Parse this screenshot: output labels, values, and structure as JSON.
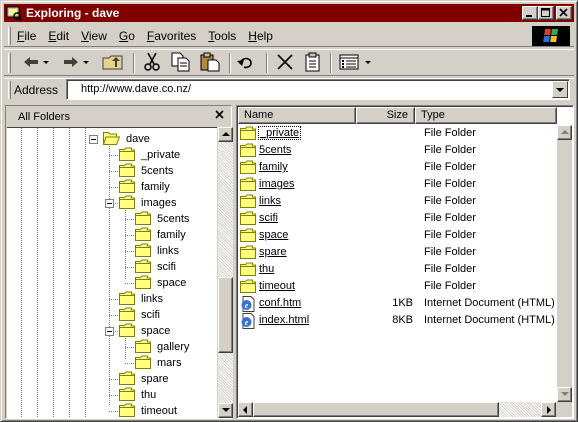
{
  "window": {
    "title": "Exploring - dave",
    "title_bar_color": "#800000"
  },
  "menu": [
    "File",
    "Edit",
    "View",
    "Go",
    "Favorites",
    "Tools",
    "Help"
  ],
  "toolbar": {
    "buttons": [
      "back-icon",
      "forward-icon",
      "up-folder-icon",
      "cut-icon",
      "copy-icon",
      "paste-icon",
      "undo-icon",
      "delete-icon",
      "properties-icon",
      "views-icon"
    ]
  },
  "address": {
    "label": "Address",
    "value": "http://www.dave.co.nz/"
  },
  "folders_pane": {
    "title": "All Folders",
    "tree": [
      {
        "label": "dave",
        "open": true
      },
      {
        "label": "_private"
      },
      {
        "label": "5cents"
      },
      {
        "label": "family"
      },
      {
        "label": "images"
      },
      {
        "label": "5cents"
      },
      {
        "label": "family"
      },
      {
        "label": "links"
      },
      {
        "label": "scifi"
      },
      {
        "label": "space"
      },
      {
        "label": "links"
      },
      {
        "label": "scifi"
      },
      {
        "label": "space"
      },
      {
        "label": "gallery"
      },
      {
        "label": "mars"
      },
      {
        "label": "spare"
      },
      {
        "label": "thu"
      },
      {
        "label": "timeout"
      }
    ]
  },
  "file_list": {
    "columns": {
      "name": "Name",
      "size": "Size",
      "type": "Type"
    },
    "rows": [
      {
        "name": "_private",
        "size": "",
        "type": "File Folder",
        "icon": "folder-icon"
      },
      {
        "name": "5cents",
        "size": "",
        "type": "File Folder",
        "icon": "folder-icon"
      },
      {
        "name": "family",
        "size": "",
        "type": "File Folder",
        "icon": "folder-icon"
      },
      {
        "name": "images",
        "size": "",
        "type": "File Folder",
        "icon": "folder-icon"
      },
      {
        "name": "links",
        "size": "",
        "type": "File Folder",
        "icon": "folder-icon"
      },
      {
        "name": "scifi",
        "size": "",
        "type": "File Folder",
        "icon": "folder-icon"
      },
      {
        "name": "space",
        "size": "",
        "type": "File Folder",
        "icon": "folder-icon"
      },
      {
        "name": "spare",
        "size": "",
        "type": "File Folder",
        "icon": "folder-icon"
      },
      {
        "name": "thu",
        "size": "",
        "type": "File Folder",
        "icon": "folder-icon"
      },
      {
        "name": "timeout",
        "size": "",
        "type": "File Folder",
        "icon": "folder-icon"
      },
      {
        "name": "conf.htm",
        "size": "1KB",
        "type": "Internet Document (HTML)",
        "icon": "html-document-icon"
      },
      {
        "name": "index.html",
        "size": "8KB",
        "type": "Internet Document (HTML)",
        "icon": "html-document-icon"
      }
    ]
  }
}
